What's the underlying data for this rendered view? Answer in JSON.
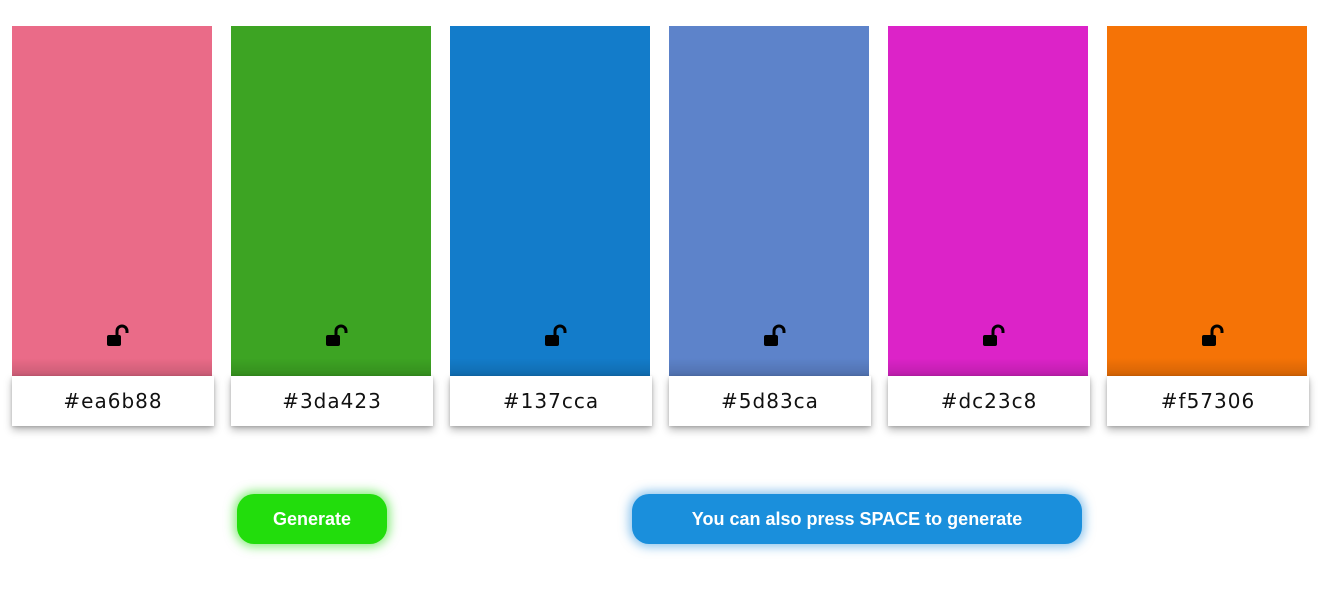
{
  "swatches": [
    {
      "hex": "#ea6b88",
      "color": "#ea6b88",
      "locked": false,
      "lock_icon": "unlocked-padlock-icon"
    },
    {
      "hex": "#3da423",
      "color": "#3da423",
      "locked": false,
      "lock_icon": "unlocked-padlock-icon"
    },
    {
      "hex": "#137cca",
      "color": "#137cca",
      "locked": false,
      "lock_icon": "unlocked-padlock-icon"
    },
    {
      "hex": "#5d83ca",
      "color": "#5d83ca",
      "locked": false,
      "lock_icon": "unlocked-padlock-icon"
    },
    {
      "hex": "#dc23c8",
      "color": "#dc23c8",
      "locked": false,
      "lock_icon": "unlocked-padlock-icon"
    },
    {
      "hex": "#f57306",
      "color": "#f57306",
      "locked": false,
      "lock_icon": "unlocked-padlock-icon"
    }
  ],
  "actions": {
    "generate_label": "Generate",
    "generate_color": "#22dd0c",
    "hint_label": "You can also press SPACE to generate",
    "hint_color": "#1a8fdc"
  }
}
